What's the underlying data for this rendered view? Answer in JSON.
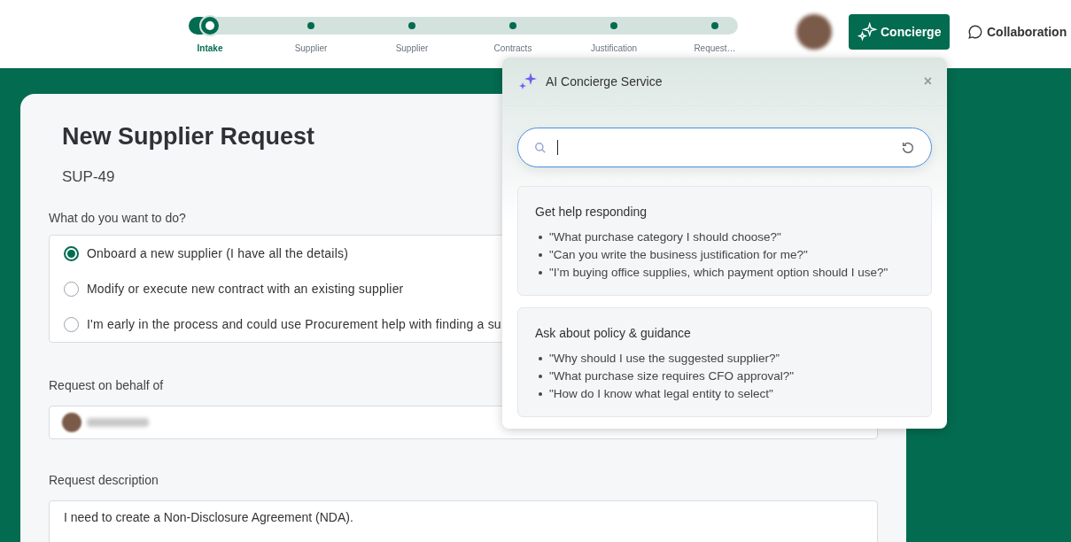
{
  "stepper": [
    {
      "label": "Intake",
      "selected": true
    },
    {
      "label": "Supplier",
      "selected": false
    },
    {
      "label": "Supplier",
      "selected": false
    },
    {
      "label": "Contracts",
      "selected": false
    },
    {
      "label": "Justification",
      "selected": false
    },
    {
      "label": "Request…",
      "selected": false
    }
  ],
  "header": {
    "concierge_button": "Concierge",
    "collaboration_button": "Collaboration"
  },
  "form": {
    "title": "New Supplier Request",
    "id": "SUP-49",
    "question": "What do you want to do?",
    "options": [
      {
        "label": "Onboard a new supplier (I have all the details)",
        "selected": true
      },
      {
        "label": "Modify or execute new contract with an existing supplier",
        "selected": false
      },
      {
        "label": "I'm early in the process and could use Procurement help with finding a su",
        "selected": false
      }
    ],
    "behalf_label": "Request on behalf of",
    "description_label": "Request description",
    "description_value": "I need to create a Non-Disclosure Agreement (NDA)."
  },
  "concierge": {
    "title": "AI Concierge Service",
    "close": "×",
    "sections": [
      {
        "title": "Get help responding",
        "items": [
          "\"What purchase category I should choose?\"",
          "\"Can you write the business justification for me?\"",
          "\"I’m buying office supplies, which payment option should I use?\""
        ]
      },
      {
        "title": "Ask about policy & guidance",
        "items": [
          "\"Why should I use the suggested supplier?”",
          "\"What purchase size requires CFO approval?\"",
          "\"How do I know what legal entity to select\""
        ]
      }
    ]
  }
}
